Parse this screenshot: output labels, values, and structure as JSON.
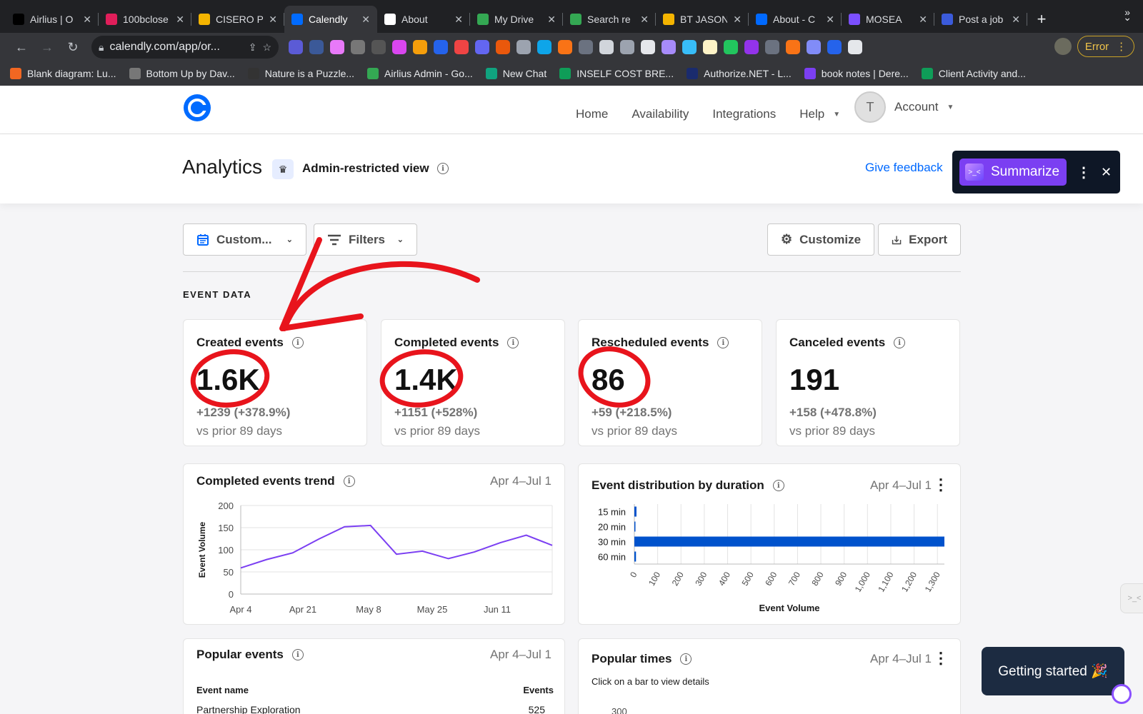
{
  "browser": {
    "tabs": [
      {
        "title": "Airlius | O",
        "color": "#000000"
      },
      {
        "title": "100bclose",
        "color": "#e01e5a"
      },
      {
        "title": "CISERO P",
        "color": "#f4b400"
      },
      {
        "title": "Calendly",
        "color": "#006bff",
        "active": true
      },
      {
        "title": "About",
        "color": "#ffffff"
      },
      {
        "title": "My Drive",
        "color": "#34a853"
      },
      {
        "title": "Search re",
        "color": "#34a853"
      },
      {
        "title": "BT JASON",
        "color": "#f4b400"
      },
      {
        "title": "About - C",
        "color": "#0069ff"
      },
      {
        "title": "MOSEA",
        "color": "#7b4fff"
      },
      {
        "title": "Post a job",
        "color": "#3b5bdb"
      }
    ],
    "url": "calendly.com/app/or...",
    "error_label": "Error",
    "bookmarks": [
      {
        "label": "Blank diagram: Lu...",
        "color": "#f26722"
      },
      {
        "label": "Bottom Up by Dav...",
        "color": "#777777"
      },
      {
        "label": "Nature is a Puzzle...",
        "color": "#333333"
      },
      {
        "label": "Airlius Admin - Go...",
        "color": "#34a853"
      },
      {
        "label": "New Chat",
        "color": "#10a37f"
      },
      {
        "label": "INSELF COST BRE...",
        "color": "#0f9d58"
      },
      {
        "label": "Authorize.NET - L...",
        "color": "#1a2b6d"
      },
      {
        "label": "book notes | Dere...",
        "color": "#7b3ff2"
      },
      {
        "label": "Client Activity and...",
        "color": "#0f9d58"
      }
    ],
    "bookmarks_more": "»"
  },
  "app": {
    "nav": [
      "Home",
      "Availability",
      "Integrations",
      "Help"
    ],
    "avatar_initial": "T",
    "account_label": "Account",
    "brand_color": "#006bff"
  },
  "page": {
    "title": "Analytics",
    "admin_label": "Admin-restricted view",
    "feedback": "Give feedback"
  },
  "summarize": {
    "label": "Summarize",
    "icon_text": ">_<"
  },
  "controls": {
    "date_filter": "Custom...",
    "filters": "Filters",
    "customize": "Customize",
    "export": "Export"
  },
  "section_label": "EVENT DATA",
  "stats": [
    {
      "label": "Created events",
      "value": "1.6K",
      "change": "+1239 (+378.9%)",
      "compare": "vs prior 89 days"
    },
    {
      "label": "Completed events",
      "value": "1.4K",
      "change": "+1151 (+528%)",
      "compare": "vs prior 89 days"
    },
    {
      "label": "Rescheduled events",
      "value": "86",
      "change": "+59 (+218.5%)",
      "compare": "vs prior 89 days"
    },
    {
      "label": "Canceled events",
      "value": "191",
      "change": "+158 (+478.8%)",
      "compare": "vs prior 89 days"
    }
  ],
  "trend": {
    "title": "Completed events trend",
    "date": "Apr 4–Jul 1"
  },
  "duration": {
    "title": "Event distribution by duration",
    "date": "Apr 4–Jul 1"
  },
  "popular_events": {
    "title": "Popular events",
    "date": "Apr 4–Jul 1",
    "col_name": "Event name",
    "col_events": "Events",
    "rows": [
      {
        "name": "Partnership Exploration",
        "events": "525"
      }
    ]
  },
  "popular_times": {
    "title": "Popular times",
    "date": "Apr 4–Jul 1",
    "hint": "Click on a bar to view details",
    "ytick_top": "300"
  },
  "getting_started": "Getting started 🎉",
  "chart_data": [
    {
      "type": "line",
      "ylabel": "Event Volume",
      "ylim": [
        0,
        200
      ],
      "yticks": [
        0,
        50,
        100,
        150,
        200
      ],
      "xticks": [
        "Apr 4",
        "Apr 21",
        "May 8",
        "May 25",
        "Jun 11"
      ],
      "grid": "horizontal",
      "color": "#7b3ff2",
      "series": [
        {
          "values": [
            59,
            78,
            93,
            124,
            152,
            155,
            90,
            97,
            80,
            95,
            116,
            133,
            110
          ]
        }
      ]
    },
    {
      "type": "bar",
      "orientation": "horizontal",
      "categories": [
        "15 min",
        "20 min",
        "30 min",
        "60 min"
      ],
      "values": [
        9,
        2,
        1330,
        7
      ],
      "xlabel": "Event Volume",
      "xlim": [
        0,
        1330
      ],
      "xticks": [
        "0",
        "100",
        "200",
        "300",
        "400",
        "500",
        "600",
        "700",
        "800",
        "900",
        "1,000",
        "1,100",
        "1,200",
        "1,300"
      ],
      "grid": "vertical",
      "color": "#0052cc"
    }
  ]
}
